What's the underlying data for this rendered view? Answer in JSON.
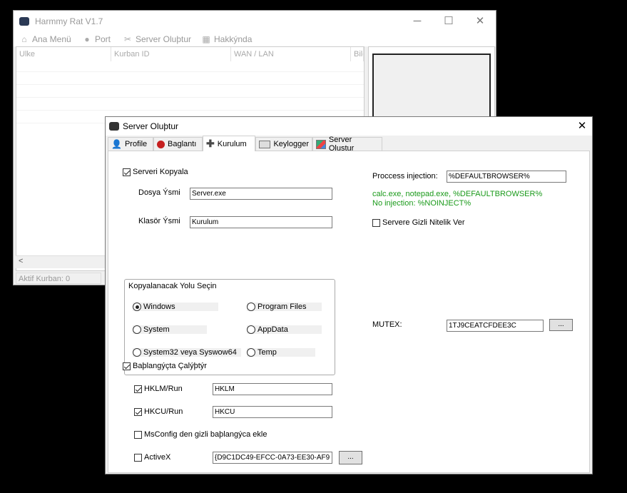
{
  "main_window": {
    "title": "Harmmy Rat V1.7",
    "window_buttons": {
      "minimize": "─",
      "maximize": "☐",
      "close": "✕"
    },
    "menu": [
      {
        "label": "Ana Menü",
        "icon": "home-icon"
      },
      {
        "label": "Port",
        "icon": "globe-icon"
      },
      {
        "label": "Server Oluþtur",
        "icon": "tools-icon"
      },
      {
        "label": "Hakkýnda",
        "icon": "info-icon"
      }
    ],
    "columns": [
      "Ulke",
      "Kurban ID",
      "WAN / LAN",
      "Bilg"
    ],
    "status": "Aktif Kurban: 0"
  },
  "dialog": {
    "title": "Server Oluþtur",
    "close": "✕",
    "tabs": [
      {
        "label": "Profile",
        "icon": "user-icon"
      },
      {
        "label": "Baglantı",
        "icon": "connection-icon"
      },
      {
        "label": "Kurulum",
        "icon": "plus-icon"
      },
      {
        "label": "Keylogger",
        "icon": "keyboard-icon"
      },
      {
        "label": "Server Oluştur",
        "icon": "build-icon"
      }
    ],
    "serveri_kopyala": {
      "label": "Serveri Kopyala",
      "checked": true
    },
    "dosya_ismi": {
      "label": "Dosya Ýsmi",
      "value": "Server.exe"
    },
    "klasor_ismi": {
      "label": "Klasör Ýsmi",
      "value": "Kurulum"
    },
    "path_group": {
      "title": "Kopyalanacak Yolu Seçin",
      "options": [
        {
          "label": "Windows",
          "selected": true
        },
        {
          "label": "Program Files",
          "selected": false
        },
        {
          "label": "System",
          "selected": false
        },
        {
          "label": "AppData",
          "selected": false
        },
        {
          "label": "System32  veya Syswow64",
          "selected": false
        },
        {
          "label": "Temp",
          "selected": false
        }
      ]
    },
    "startup": {
      "label": "Baþlangýçta Çalýþtýr",
      "checked": true
    },
    "hklm": {
      "label": "HKLM/Run",
      "checked": true,
      "value": "HKLM"
    },
    "hkcu": {
      "label": "HKCU/Run",
      "checked": true,
      "value": "HKCU"
    },
    "msconfig": {
      "label": "MsConfig den gizli baþlangýca ekle",
      "checked": false
    },
    "activex": {
      "label": "ActiveX",
      "checked": false,
      "value": "{D9C1DC49-EFCC-0A73-EE30-AF9"
    },
    "process_injection": {
      "label": "Proccess injection:",
      "value": "%DEFAULTBROWSER%"
    },
    "injection_hint_1": "calc.exe, notepad.exe, %DEFAULTBROWSER%",
    "injection_hint_2": "No injection: %NOINJECT%",
    "hidden_attr": {
      "label": "Servere Gizli Nitelik Ver",
      "checked": false
    },
    "mutex": {
      "label": "MUTEX:",
      "value": "1TJ9CEATCFDEE3C"
    },
    "browse_label": "..."
  },
  "colors": {
    "green_hint": "#1a9a1a",
    "titlebar": "#ffffff",
    "window_bg": "#f0f0f0"
  }
}
